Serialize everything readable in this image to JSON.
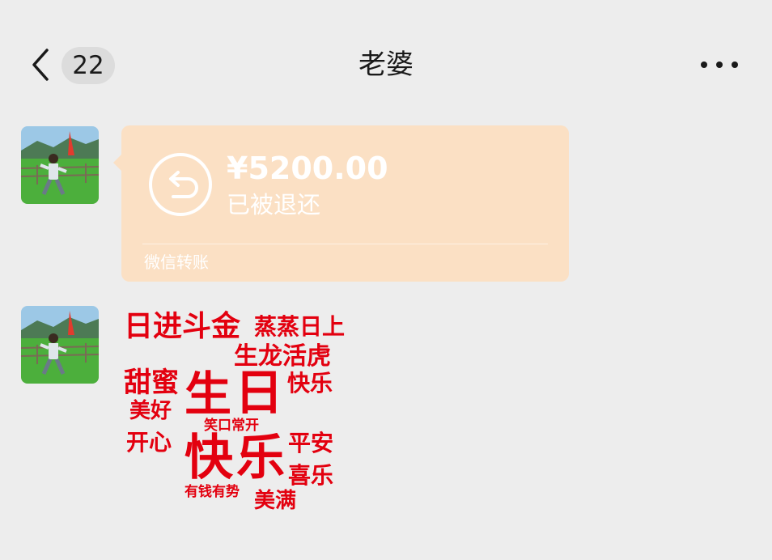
{
  "header": {
    "unread_count": "22",
    "title": "老婆",
    "back_icon": "chevron-left-icon",
    "more_icon": "more-horizontal-icon"
  },
  "messages": [
    {
      "type": "transfer",
      "amount": "¥5200.00",
      "status": "已被退还",
      "footer": "微信转账",
      "icon": "refund-icon",
      "bubble_color": "#fbe0c4"
    },
    {
      "type": "image",
      "words": [
        "日进斗金",
        "蒸蒸日上",
        "生龙活虎",
        "甜蜜",
        "生",
        "日",
        "快乐",
        "美好",
        "笑口常开",
        "开心",
        "快",
        "乐",
        "平安",
        "喜乐",
        "有钱有势",
        "美满"
      ],
      "word_color": "#e3000f"
    }
  ],
  "colors": {
    "background": "#ededed",
    "accent_red": "#e3000f"
  }
}
